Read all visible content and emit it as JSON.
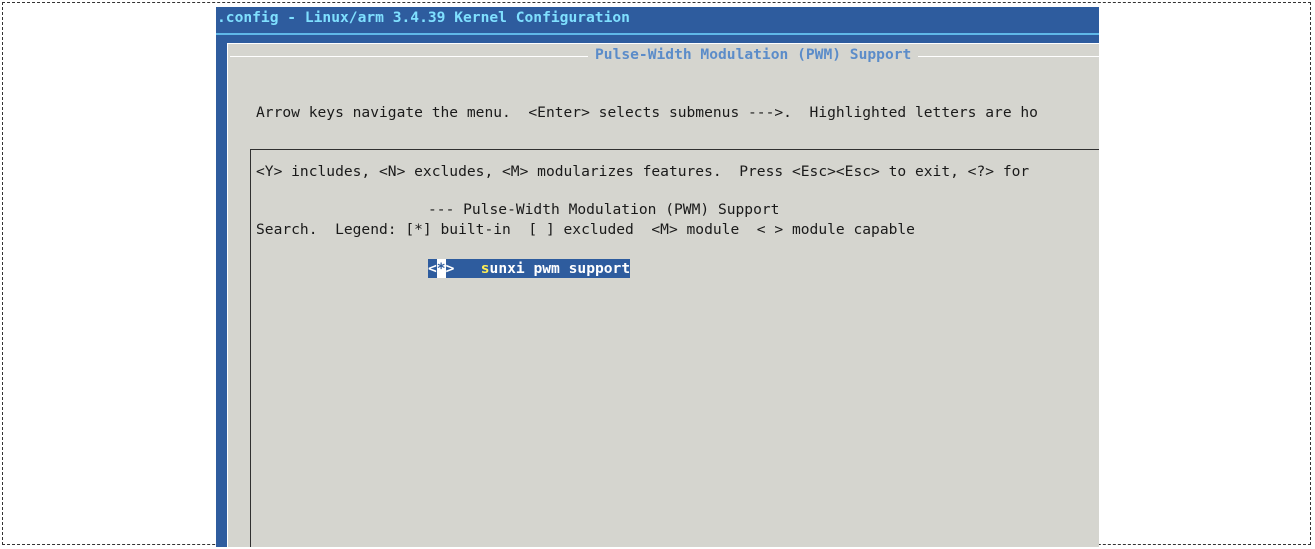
{
  "window": {
    "title": ".config - Linux/arm 3.4.39 Kernel Configuration"
  },
  "dialog": {
    "title": "Pulse-Width Modulation (PWM) Support",
    "help_lines": [
      "Arrow keys navigate the menu.  <Enter> selects submenus --->.  Highlighted letters are ho",
      "<Y> includes, <N> excludes, <M> modularizes features.  Press <Esc><Esc> to exit, <?> for",
      "Search.  Legend: [*] built-in  [ ] excluded  <M> module  < > module capable"
    ]
  },
  "menu": {
    "items": [
      {
        "text": "--- Pulse-Width Modulation (PWM) Support",
        "selected": false
      },
      {
        "open_bracket": "<",
        "state": "*",
        "close_bracket": ">",
        "gap": "   ",
        "hotkey": "s",
        "label_rest": "unxi pwm support",
        "selected": true
      }
    ]
  },
  "colors": {
    "screen_background": "#2e5c9e",
    "dialog_background": "#d5d5cf",
    "title_text": "#7fe0ff",
    "dialog_title_text": "#5b8cc9",
    "selection_background": "#2e5c9e",
    "hotkey": "#ffee55"
  }
}
